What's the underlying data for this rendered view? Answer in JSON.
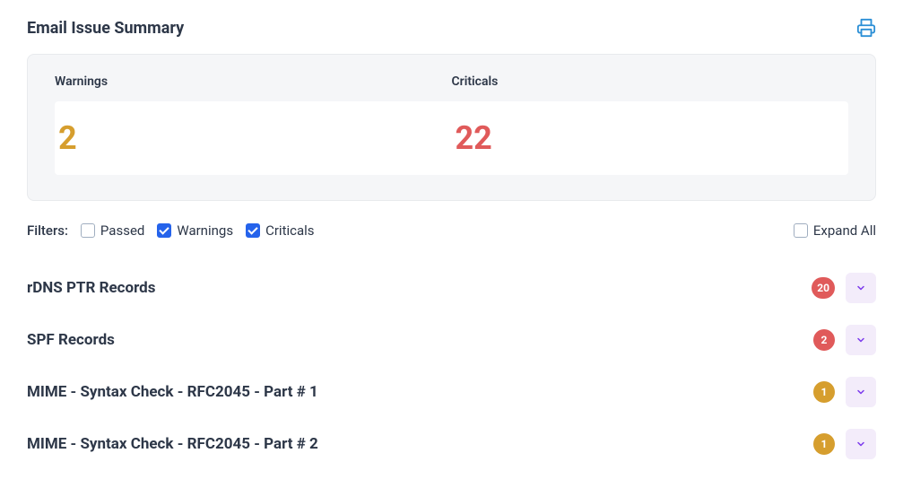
{
  "title": "Email Issue Summary",
  "summary": {
    "warnings_label": "Warnings",
    "warnings_value": "2",
    "criticals_label": "Criticals",
    "criticals_value": "22"
  },
  "filters": {
    "label": "Filters:",
    "passed": "Passed",
    "warnings": "Warnings",
    "criticals": "Criticals",
    "expand_all": "Expand All"
  },
  "issues": [
    {
      "title": "rDNS PTR Records",
      "count": "20",
      "severity": "critical"
    },
    {
      "title": "SPF Records",
      "count": "2",
      "severity": "critical"
    },
    {
      "title": "MIME - Syntax Check - RFC2045 - Part # 1",
      "count": "1",
      "severity": "warning"
    },
    {
      "title": "MIME - Syntax Check - RFC2045 - Part # 2",
      "count": "1",
      "severity": "warning"
    }
  ],
  "colors": {
    "warning": "#d69e2e",
    "critical": "#e05a5a",
    "accent": "#7c3aed",
    "checkbox_checked": "#2563eb"
  }
}
